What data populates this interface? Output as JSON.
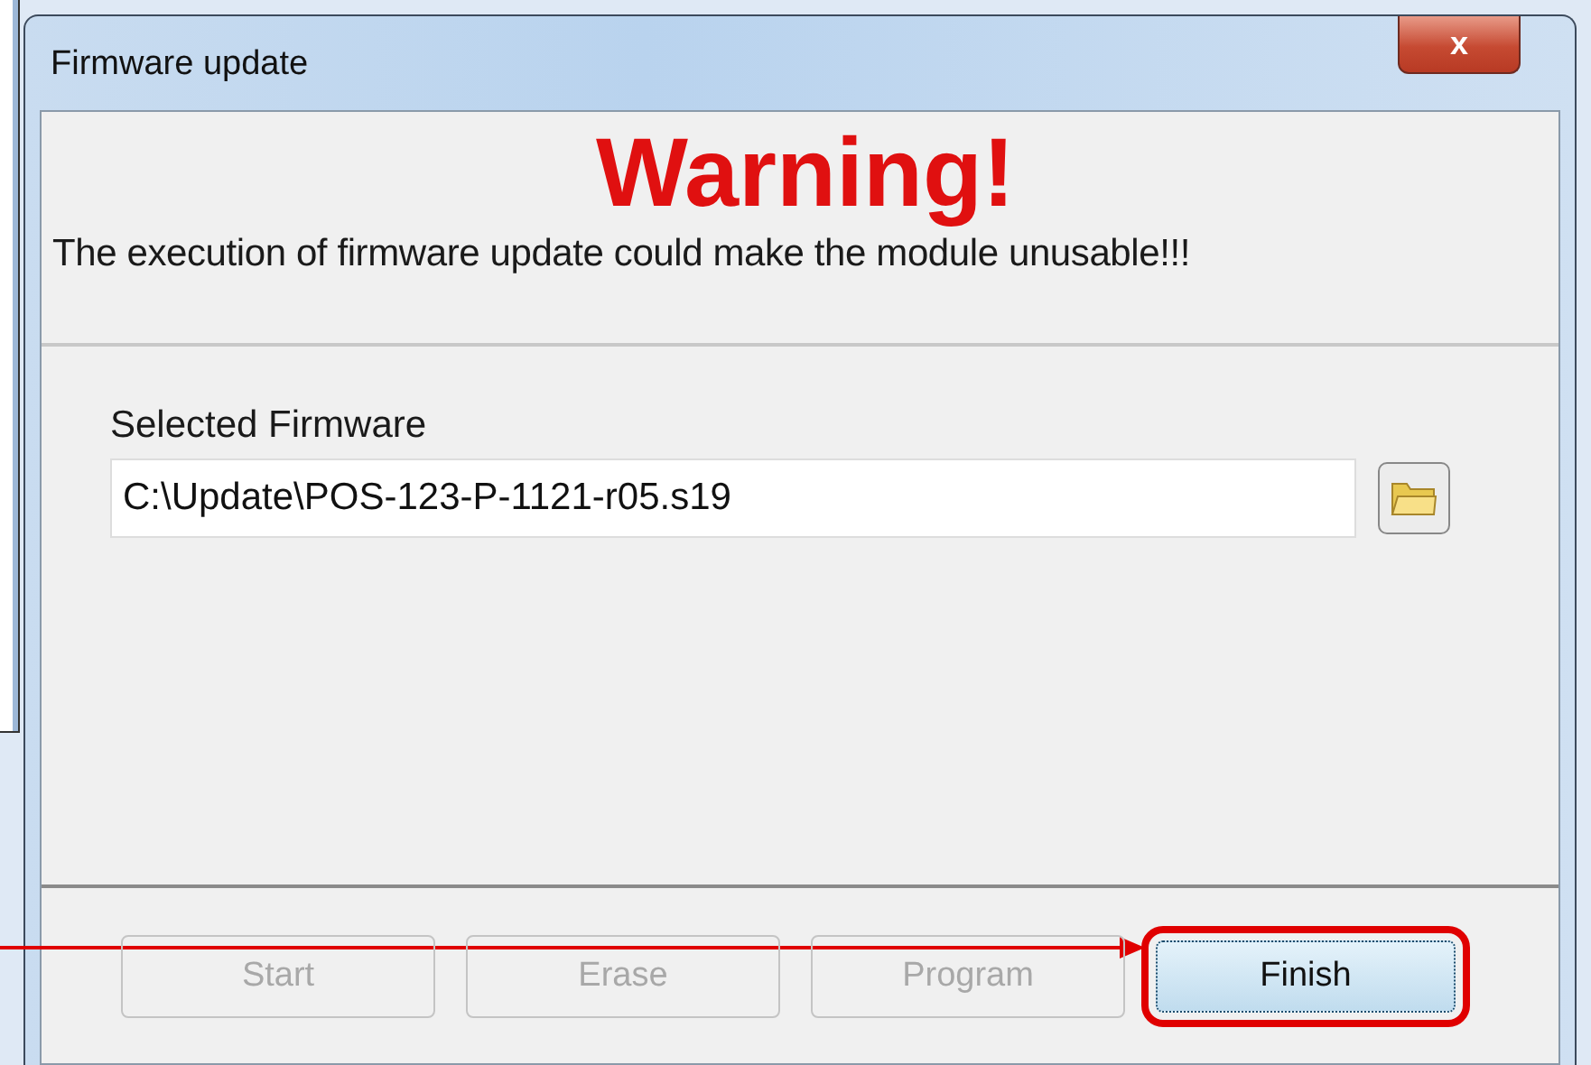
{
  "window": {
    "title": "Firmware update",
    "close": "x"
  },
  "warning": {
    "heading": "Warning!",
    "message": "The execution of firmware update could make the module unusable!!!"
  },
  "firmware": {
    "label": "Selected Firmware",
    "value": "C:\\Update\\POS-123-P-1121-r05.s19"
  },
  "buttons": [
    {
      "label": "Start",
      "disabled": true,
      "highlighted": false
    },
    {
      "label": "Erase",
      "disabled": true,
      "highlighted": false
    },
    {
      "label": "Program",
      "disabled": true,
      "highlighted": false
    },
    {
      "label": "Finish",
      "disabled": false,
      "highlighted": true
    }
  ]
}
